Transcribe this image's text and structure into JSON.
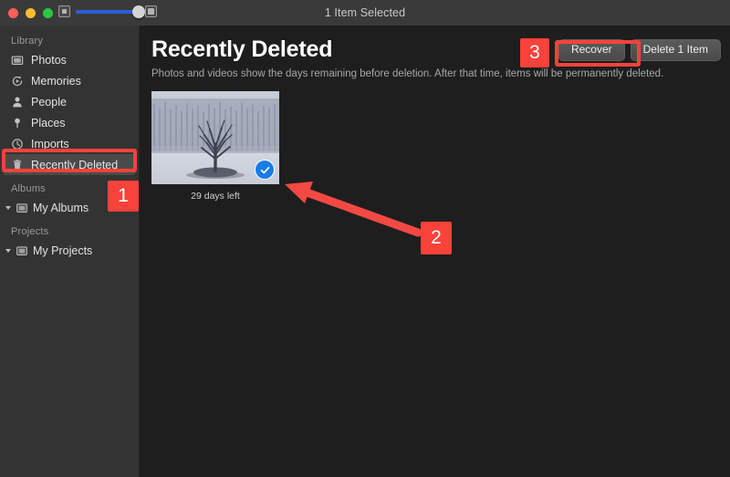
{
  "window": {
    "title": "1 Item Selected",
    "traffic_lights": [
      "close-button",
      "minimize-button",
      "maximize-button"
    ],
    "zoom_slider": {
      "min_icon": "small-thumbnail-icon",
      "max_icon": "large-thumbnail-icon",
      "value": 100
    }
  },
  "sidebar": {
    "sections": [
      {
        "label": "Library",
        "items": [
          {
            "label": "Photos",
            "icon": "photos-icon",
            "selected": false
          },
          {
            "label": "Memories",
            "icon": "memories-icon",
            "selected": false
          },
          {
            "label": "People",
            "icon": "people-icon",
            "selected": false
          },
          {
            "label": "Places",
            "icon": "places-pin-icon",
            "selected": false
          },
          {
            "label": "Imports",
            "icon": "imports-clock-icon",
            "selected": false
          },
          {
            "label": "Recently Deleted",
            "icon": "trash-icon",
            "selected": true
          }
        ]
      },
      {
        "label": "Albums",
        "items": [
          {
            "label": "My Albums",
            "icon": "album-folder-icon",
            "selected": false
          }
        ]
      },
      {
        "label": "Projects",
        "items": [
          {
            "label": "My Projects",
            "icon": "project-folder-icon",
            "selected": false
          }
        ]
      }
    ]
  },
  "main": {
    "title": "Recently Deleted",
    "subtitle": "Photos and videos show the days remaining before deletion. After that time, items will be permanently deleted.",
    "toolbar": {
      "recover_label": "Recover",
      "delete_label": "Delete 1 Item"
    },
    "photos": [
      {
        "caption": "29 days left",
        "selected": true,
        "alt": "snowy-field-with-bare-tree"
      }
    ]
  },
  "annotations": {
    "accent_color": "#f9423a",
    "badges": [
      {
        "label": "1",
        "target": "sidebar-recently-deleted"
      },
      {
        "label": "2",
        "target": "photo-selection-checkmark"
      },
      {
        "label": "3",
        "target": "recover-button"
      }
    ],
    "arrow": "points-up-left-to-selection-checkmark"
  },
  "colors": {
    "sidebar_bg": "#333333",
    "content_bg": "#1e1e1e",
    "titlebar_bg": "#3a3a3a",
    "selection_blue": "#1a7ce8",
    "slider_blue": "#2c5fd6"
  }
}
